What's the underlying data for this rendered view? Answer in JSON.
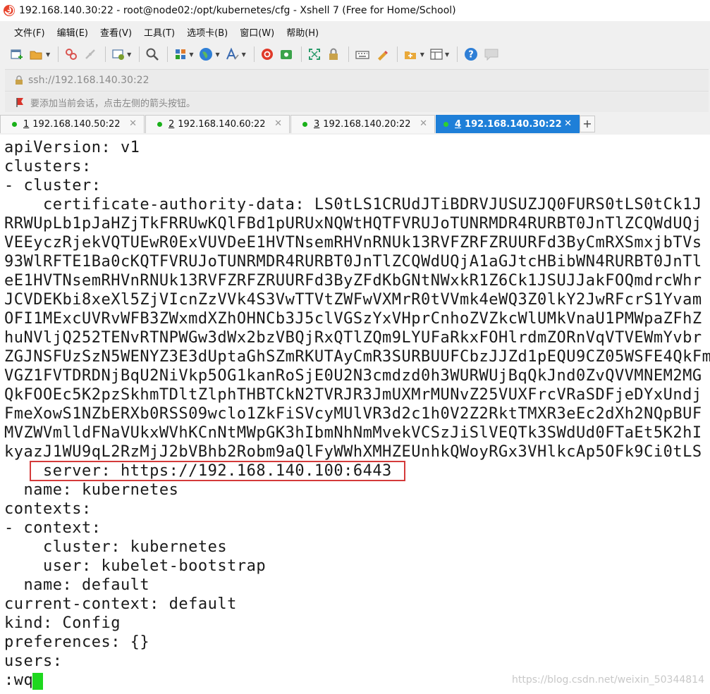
{
  "window": {
    "title": "192.168.140.30:22 - root@node02:/opt/kubernetes/cfg - Xshell 7 (Free for Home/School)"
  },
  "menu": [
    "文件(F)",
    "编辑(E)",
    "查看(V)",
    "工具(T)",
    "选项卡(B)",
    "窗口(W)",
    "帮助(H)"
  ],
  "toolbar": {
    "icons": [
      "new-session-icon",
      "open-folder-icon",
      "reconnect-icon",
      "disconnect-icon",
      "properties-icon",
      "search-icon",
      "transfer-icon",
      "globe-icon",
      "font-icon",
      "xftp-icon",
      "xmanager-icon",
      "fullscreen-icon",
      "lock-icon",
      "keyboard-icon",
      "highlight-icon",
      "compose-icon",
      "layout-icon",
      "help-icon",
      "chat-icon"
    ]
  },
  "address": {
    "value": "ssh://192.168.140.30:22"
  },
  "hint": {
    "text": "要添加当前会话，点击左侧的箭头按钮。"
  },
  "tabs": [
    {
      "num": "1",
      "host": "192.168.140.50:22",
      "active": false
    },
    {
      "num": "2",
      "host": "192.168.140.60:22",
      "active": false
    },
    {
      "num": "3",
      "host": "192.168.140.20:22",
      "active": false
    },
    {
      "num": "4",
      "host": "192.168.140.30:22",
      "active": true
    }
  ],
  "tab_add_label": "+",
  "tab_close_label": "✕",
  "terminal": {
    "lines": [
      "apiVersion: v1",
      "clusters:",
      "- cluster:",
      "    certificate-authority-data: LS0tLS1CRUdJTiBDRVJUSUZJQ0FURS0tLS0tCk1J",
      "RRWUpLb1pJaHZjTkFRRUwKQlFBd1pURUxNQWtHQTFVRUJoTUNRMDR4RURBT0JnTlZCQWdUQj",
      "VEEyczRjekVQTUEwR0ExVUVDeE1HVTNsemRHVnRNUk13RVFZRFZRUURFd3ByCmRXSmxjbTVs",
      "93WlRFTE1Ba0cKQTFVRUJoTUNRMDR4RURBT0JnTlZCQWdUQjA1aGJtcHBibWN4RURBT0JnTl",
      "eE1HVTNsemRHVnRNUk13RVFZRFZRUURFd3ByZFdKbGNtNWxkR1Z6Ck1JSUJJakFOQmdrcWhr",
      "JCVDEKbi8xeXl5ZjVIcnZzVVk4S3VwTTVtZWFwVXMrR0tVVmk4eWQ3Z0lkY2JwRFcrS1Yvam",
      "OFI1MExcUVRvWFB3ZWxmdXZhOHNCb3J5clVGSzYxVHprCnhoZVZkcWlUMkVnaU1PMWpaZFhZ",
      "huNVljQ252TENvRTNPWGw3dWx2bzVBQjRxQTlZQm9LYUFaRkxFOHlrdmZORnVqVTVEWmYvbr",
      "ZGJNSFUzSzN5WENYZ3E3dUptaGhSZmRKUTAyCmR3SURBUUFCbzJJZd1pEQU9CZ05WSFE4QkFm",
      "VGZ1FVTDRDNjBqU2NiVkp5OG1kanRoSjE0U2N3cmdzd0h3WURWUjBqQkJnd0ZvQVVMNEM2MG",
      "QkFOOEc5K2pzSkhmTDltZlphTHBTCkN2TVRJR3JmUXMrMUNvZ25VUXFrcVRaSDFjeDYxUndj",
      "FmeXowS1NZbERXb0RSS09wclo1ZkFiSVcyMUlVR3d2c1h0V2Z2RktTMXR3eEc2dXh2NQpBUF",
      "MVZWVmlldFNaVUkxWVhKCnNtMWpGK3hIbmNhNmMvekVCSzJiSlVEQTk3SWdUd0FTaEt5K2hI",
      "kyazJ1WU9qL2RzMjJ2bVBhb2Robm9aQlFyWWhXMHZEUnhkQWoyRGx3VHlkcAp5OFk9Ci0tLS",
      "    server: https://192.168.140.100:6443",
      "  name: kubernetes",
      "contexts:",
      "- context:",
      "    cluster: kubernetes",
      "    user: kubelet-bootstrap",
      "  name: default",
      "current-context: default",
      "kind: Config",
      "preferences: {}",
      "users:",
      ":wq"
    ]
  },
  "watermark": "https://blog.csdn.net/weixin_50344814",
  "colors": {
    "accent": "#1e7fd8",
    "highlight_box": "#d43a3a",
    "cursor": "#1ed81e",
    "session_dot": "#19b019"
  }
}
